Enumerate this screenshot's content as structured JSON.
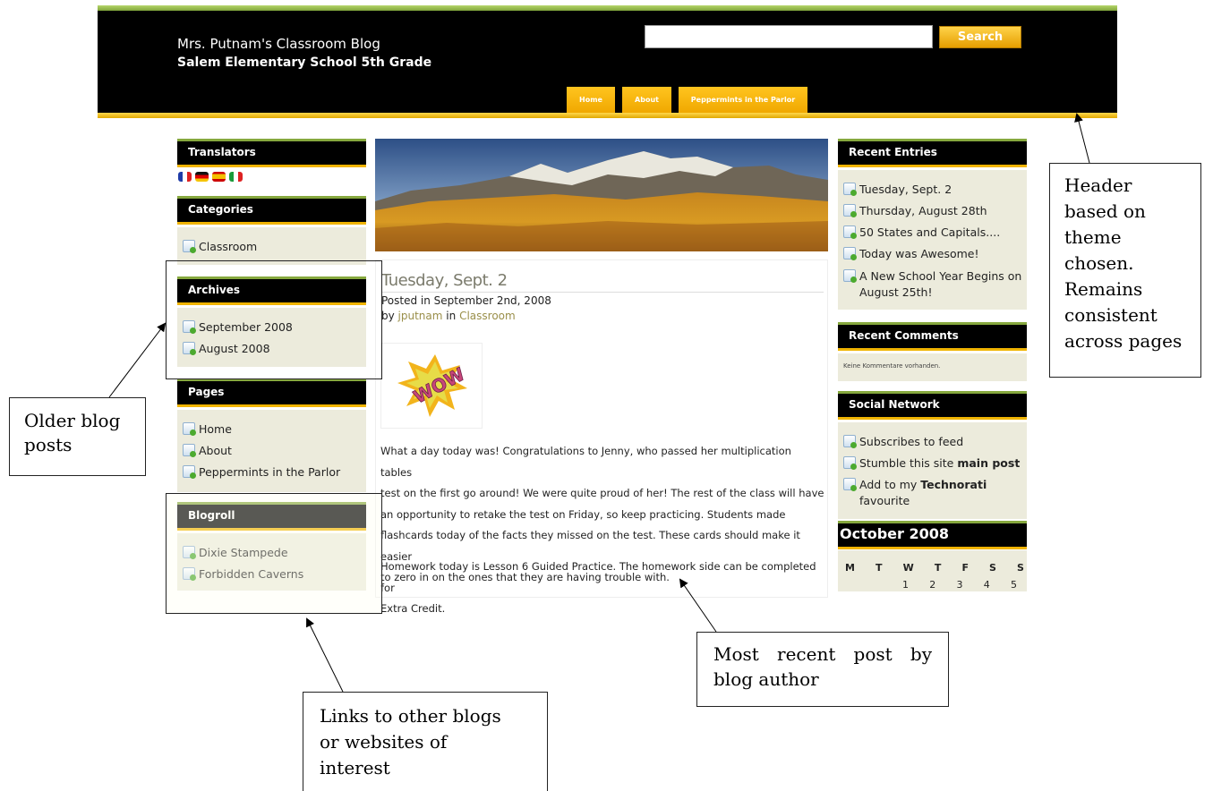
{
  "header": {
    "title": "Mrs. Putnam's Classroom Blog",
    "subtitle": "Salem Elementary School 5th Grade",
    "search_button": "Search",
    "nav": [
      "Home",
      "About",
      "Peppermints in the Parlor"
    ]
  },
  "sidebar_left": {
    "translators": {
      "title": "Translators"
    },
    "categories": {
      "title": "Categories",
      "items": [
        "Classroom"
      ]
    },
    "archives": {
      "title": "Archives",
      "items": [
        "September 2008",
        "August 2008"
      ]
    },
    "pages": {
      "title": "Pages",
      "items": [
        "Home",
        "About",
        "Peppermints in the Parlor"
      ]
    },
    "blogroll": {
      "title": "Blogroll",
      "items": [
        "Dixie Stampede",
        "Forbidden Caverns"
      ]
    }
  },
  "post": {
    "title": "Tuesday, Sept. 2",
    "posted": "Posted in September 2nd, 2008",
    "by": "by",
    "author": "jputnam",
    "in": "in",
    "category": "Classroom",
    "image_text": "WOW",
    "paragraph1_lines": [
      "What a day today was! Congratulations to Jenny, who passed her multiplication tables",
      "test on the first go around! We were quite proud of her! The rest of the class will have",
      "an opportunity to retake the test on Friday, so keep practicing. Students made",
      "flashcards today of the facts they missed on the test.  These cards should make it easier",
      "to zero in on the ones that they are having trouble with."
    ],
    "paragraph2_lines": [
      "Homework today is Lesson 6 Guided Practice. The homework side can be completed for",
      "Extra Credit."
    ]
  },
  "sidebar_right": {
    "recent_entries": {
      "title": "Recent Entries",
      "items": [
        "Tuesday, Sept. 2",
        "Thursday, August 28th",
        "50 States and Capitals....",
        "Today was Awesome!",
        "A New School Year Begins on",
        "August 25th!"
      ]
    },
    "recent_comments": {
      "title": "Recent Comments",
      "text": "Keine Kommentare vorhanden."
    },
    "social": {
      "title": "Social Network",
      "feed": "Subscribes to feed",
      "stumble_pre": "Stumble this site ",
      "stumble_bold": "main post",
      "techno_pre": "Add to my ",
      "techno_bold": "Technorati",
      "techno_post": "favourite"
    },
    "calendar": {
      "title": "October 2008",
      "days": [
        "M",
        "T",
        "W",
        "T",
        "F",
        "S",
        "S"
      ],
      "first_row": [
        "1",
        "2",
        "3",
        "4",
        "5"
      ]
    }
  },
  "annotations": {
    "header": [
      "Header",
      "based on",
      "theme",
      "chosen.",
      "Remains",
      "consistent",
      "across pages"
    ],
    "older": [
      "Older blog",
      "posts"
    ],
    "links": [
      "Links to other blogs",
      "or websites of",
      "interest"
    ],
    "recent": [
      "Most recent post by",
      "blog author"
    ]
  }
}
